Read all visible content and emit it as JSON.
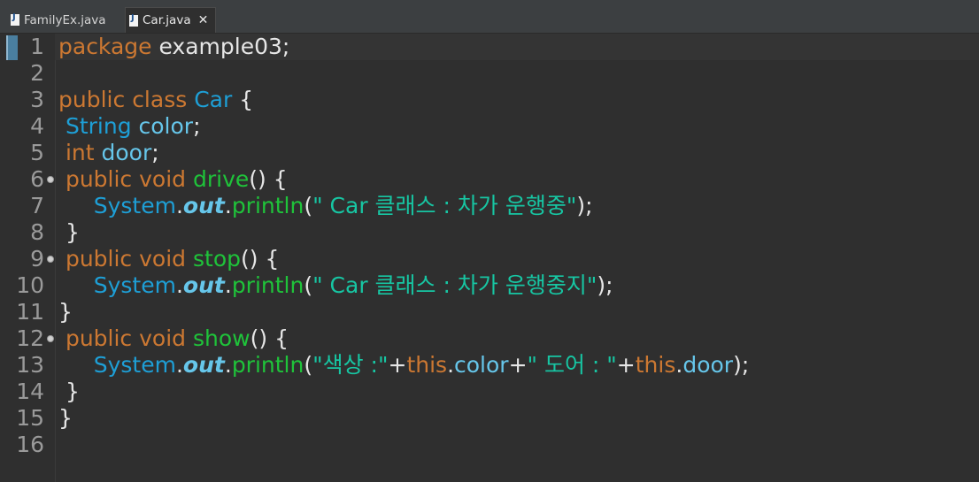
{
  "tabs": [
    {
      "label": "FamilyEx.java",
      "active": false,
      "icon": "java-file-icon"
    },
    {
      "label": "Car.java",
      "active": true,
      "icon": "java-file-icon",
      "close": "✕"
    }
  ],
  "editor": {
    "current_line": 1,
    "lines": [
      {
        "n": "1",
        "fold": false,
        "tokens": [
          [
            "kw",
            "package"
          ],
          [
            "pl",
            " example03;"
          ]
        ]
      },
      {
        "n": "2",
        "fold": false,
        "tokens": []
      },
      {
        "n": "3",
        "fold": false,
        "tokens": [
          [
            "kw",
            "public"
          ],
          [
            "pl",
            " "
          ],
          [
            "kw",
            "class"
          ],
          [
            "pl",
            " "
          ],
          [
            "ty",
            "Car"
          ],
          [
            "pl",
            " {"
          ]
        ]
      },
      {
        "n": "4",
        "fold": false,
        "tokens": [
          [
            "pl",
            " "
          ],
          [
            "ty",
            "String"
          ],
          [
            "pl",
            " "
          ],
          [
            "fd",
            "color"
          ],
          [
            "pl",
            ";"
          ]
        ]
      },
      {
        "n": "5",
        "fold": false,
        "tokens": [
          [
            "pl",
            " "
          ],
          [
            "kw",
            "int"
          ],
          [
            "pl",
            " "
          ],
          [
            "fd",
            "door"
          ],
          [
            "pl",
            ";"
          ]
        ]
      },
      {
        "n": "6",
        "fold": true,
        "tokens": [
          [
            "pl",
            " "
          ],
          [
            "kw",
            "public"
          ],
          [
            "pl",
            " "
          ],
          [
            "kw",
            "void"
          ],
          [
            "pl",
            " "
          ],
          [
            "mt",
            "drive"
          ],
          [
            "pl",
            "() {"
          ]
        ]
      },
      {
        "n": "7",
        "fold": false,
        "tokens": [
          [
            "pl",
            "     "
          ],
          [
            "ty",
            "System"
          ],
          [
            "pl",
            "."
          ],
          [
            "st",
            "out"
          ],
          [
            "pl",
            "."
          ],
          [
            "mt",
            "println"
          ],
          [
            "pl",
            "("
          ],
          [
            "str",
            "\" Car 클래스 : 차가 운행중\""
          ],
          [
            "pl",
            ");"
          ]
        ]
      },
      {
        "n": "8",
        "fold": false,
        "tokens": [
          [
            "pl",
            " }"
          ]
        ]
      },
      {
        "n": "9",
        "fold": true,
        "tokens": [
          [
            "pl",
            " "
          ],
          [
            "kw",
            "public"
          ],
          [
            "pl",
            " "
          ],
          [
            "kw",
            "void"
          ],
          [
            "pl",
            " "
          ],
          [
            "mt",
            "stop"
          ],
          [
            "pl",
            "() {"
          ]
        ]
      },
      {
        "n": "10",
        "fold": false,
        "tokens": [
          [
            "pl",
            "     "
          ],
          [
            "ty",
            "System"
          ],
          [
            "pl",
            "."
          ],
          [
            "st",
            "out"
          ],
          [
            "pl",
            "."
          ],
          [
            "mt",
            "println"
          ],
          [
            "pl",
            "("
          ],
          [
            "str",
            "\" Car 클래스 : 차가 운행중지\""
          ],
          [
            "pl",
            ");"
          ]
        ]
      },
      {
        "n": "11",
        "fold": false,
        "tokens": [
          [
            "pl",
            "}"
          ]
        ]
      },
      {
        "n": "12",
        "fold": true,
        "tokens": [
          [
            "pl",
            " "
          ],
          [
            "kw",
            "public"
          ],
          [
            "pl",
            " "
          ],
          [
            "kw",
            "void"
          ],
          [
            "pl",
            " "
          ],
          [
            "mt",
            "show"
          ],
          [
            "pl",
            "() {"
          ]
        ]
      },
      {
        "n": "13",
        "fold": false,
        "tokens": [
          [
            "pl",
            "     "
          ],
          [
            "ty",
            "System"
          ],
          [
            "pl",
            "."
          ],
          [
            "st",
            "out"
          ],
          [
            "pl",
            "."
          ],
          [
            "mt",
            "println"
          ],
          [
            "pl",
            "("
          ],
          [
            "str",
            "\"색상 :\""
          ],
          [
            "pl",
            "+"
          ],
          [
            "kw",
            "this"
          ],
          [
            "pl",
            "."
          ],
          [
            "fd",
            "color"
          ],
          [
            "pl",
            "+"
          ],
          [
            "str",
            "\" 도어 : \""
          ],
          [
            "pl",
            "+"
          ],
          [
            "kw",
            "this"
          ],
          [
            "pl",
            "."
          ],
          [
            "fd",
            "door"
          ],
          [
            "pl",
            ");"
          ]
        ]
      },
      {
        "n": "14",
        "fold": false,
        "tokens": [
          [
            "pl",
            " }"
          ]
        ]
      },
      {
        "n": "15",
        "fold": false,
        "tokens": [
          [
            "pl",
            "}"
          ]
        ]
      },
      {
        "n": "16",
        "fold": false,
        "tokens": []
      }
    ]
  },
  "colors": {
    "keyword": "#cc7832",
    "type": "#1e9fd6",
    "field": "#66c6ea",
    "method": "#1fc33a",
    "string": "#17c6a3",
    "background": "#2f2f2f"
  }
}
